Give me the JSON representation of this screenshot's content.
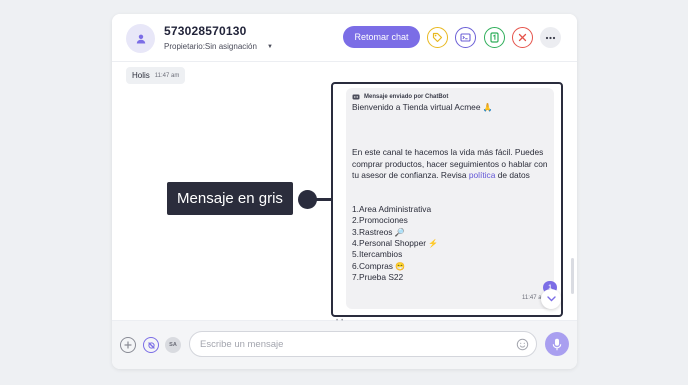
{
  "header": {
    "phone": "573028570130",
    "owner_label": "Propietario:Sin asignación",
    "retomar_label": "Retomar chat",
    "icons": [
      "person-icon",
      "tag-icon",
      "terminal-icon",
      "whatsapp-icon",
      "close-icon",
      "more-icon"
    ],
    "colors": {
      "accent": "#7b6de6",
      "tag": "#e8b820",
      "terminal": "#6b5fd6",
      "whatsapp": "#2fae5a",
      "close": "#e5534b"
    }
  },
  "chat": {
    "incoming": {
      "text": "Holis",
      "time": "11:47 am"
    },
    "bot": {
      "header": "Mensaje enviado por ChatBot",
      "greeting": "Bienvenido a Tienda virtual Acmee",
      "para1": "En este canal te hacemos la vida más fácil. Puedes comprar productos, hacer seguimientos o hablar con tu asesor de confianza. Revisa",
      "link": "política",
      "para1_end": "de datos",
      "options": [
        "1.Area Administrativa",
        "2.Promociones",
        "3.Rastreos",
        "4.Personal Shopper",
        "5.Itercambios",
        "6.Compras",
        "7.Prueba S22"
      ],
      "time": "11:47 a"
    },
    "unread_count": "1"
  },
  "composer": {
    "placeholder": "Escribe un mensaje",
    "avatar_initials": "SA"
  },
  "annotation": {
    "label": "Mensaje en gris"
  }
}
